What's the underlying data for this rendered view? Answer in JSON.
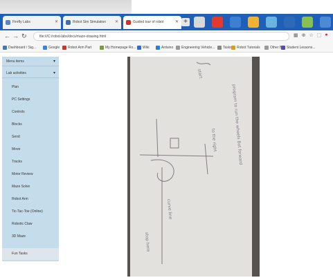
{
  "browser": {
    "tabs": [
      {
        "label": "Firefly Labs",
        "favicon_color": "#5a86c8"
      },
      {
        "label": "Robot Sim Simulation",
        "favicon_color": "#3a6fb8"
      },
      {
        "label": "Guided tour of robot",
        "favicon_color": "#c8342b"
      }
    ],
    "new_tab_label": "+",
    "address": "file:///C:/robot-labs/docs/maze-drawing.html",
    "bookmarks": [
      {
        "label": "Dashboard / Sig...",
        "color": "#4a76b5"
      },
      {
        "label": "Google",
        "color": "#3b82d6"
      },
      {
        "label": "Robot Arm Part",
        "color": "#c0392b"
      },
      {
        "label": "My Homepage Ro...",
        "color": "#7a9c3b"
      },
      {
        "label": "Wiki",
        "color": "#2f6bd1"
      },
      {
        "label": "Arduino",
        "color": "#2a7fd4"
      },
      {
        "label": "Engineering Vehicle...",
        "color": "#999999"
      },
      {
        "label": "Tasks",
        "color": "#888888"
      },
      {
        "label": "Robot Tutorials",
        "color": "#d4a017"
      },
      {
        "label": "Other Bks",
        "color": "#999999"
      },
      {
        "label": "Student Lessons...",
        "color": "#5a4aa8"
      }
    ]
  },
  "sidebar": {
    "header": "Menu items",
    "section": "Lab activities",
    "items": [
      "Plan",
      "PC Settings",
      "Controls",
      "Blocks",
      "Send",
      "Move",
      "Tracks",
      "Motor Review",
      "Maze Solve",
      "Robot Arm",
      "Tic-Tac-Toe (Online)",
      "Robotic Claw",
      "3D Maze",
      "Fun Tasks"
    ],
    "selected_index": 13
  },
  "document": {
    "annotations": [
      "start",
      "program to run the wheels Bot forward",
      "to the right",
      "curve line",
      "stop here"
    ]
  }
}
